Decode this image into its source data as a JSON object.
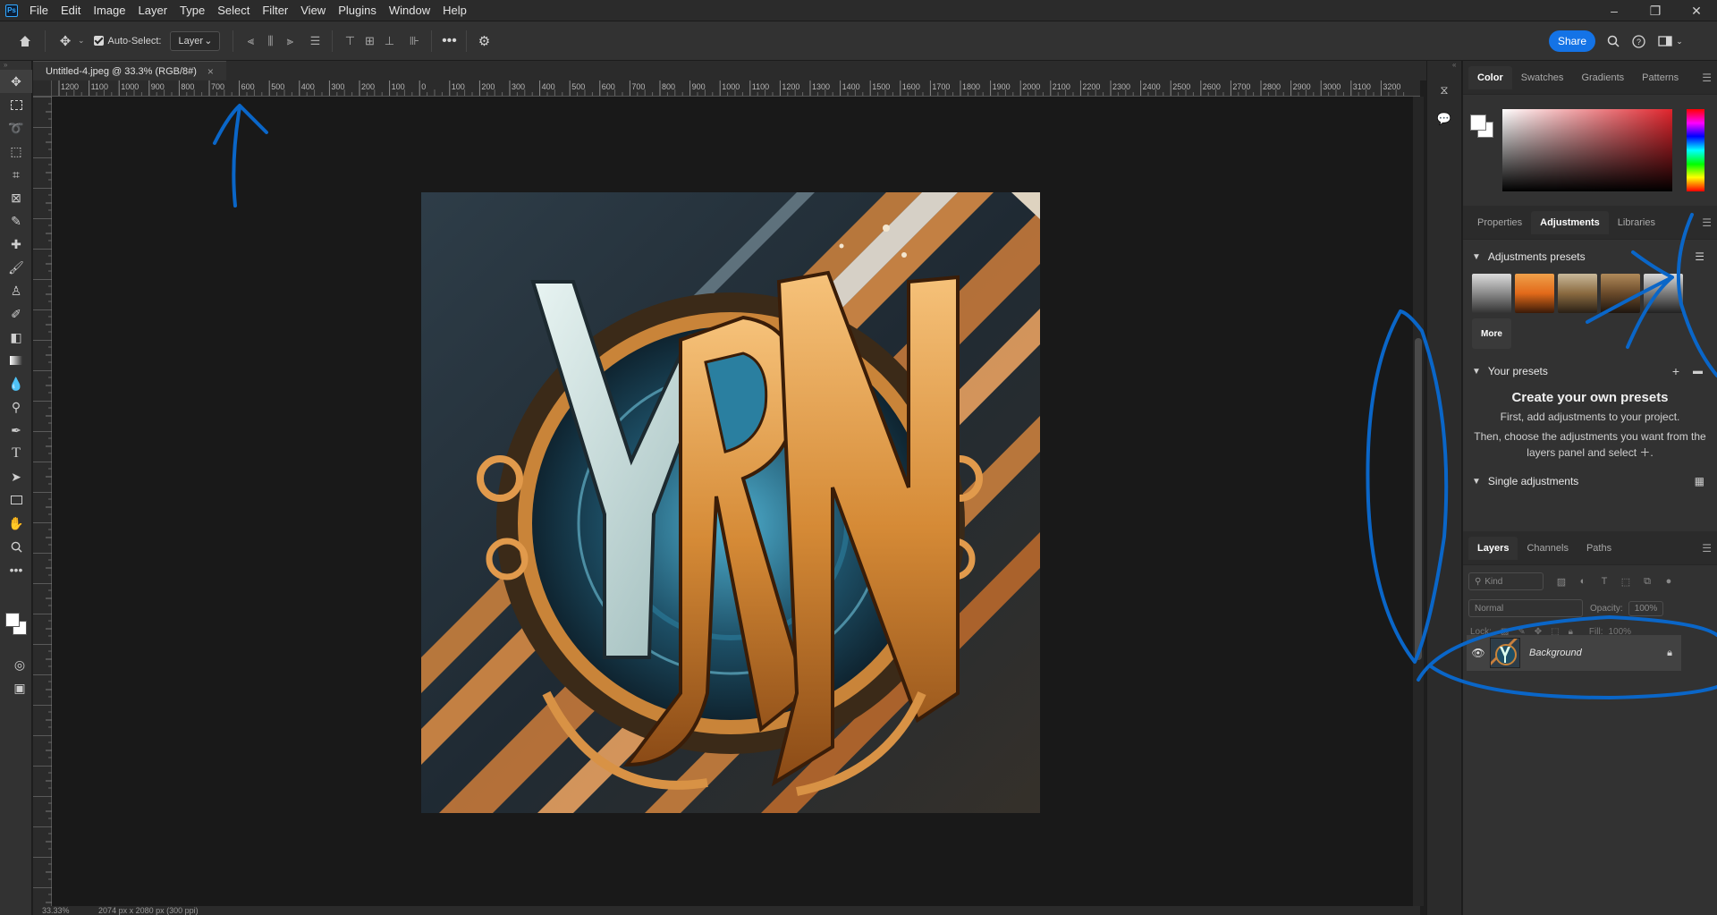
{
  "app": {
    "logo": "Ps"
  },
  "menu": [
    "File",
    "Edit",
    "Image",
    "Layer",
    "Type",
    "Select",
    "Filter",
    "View",
    "Plugins",
    "Window",
    "Help"
  ],
  "window_controls": {
    "minimize": "–",
    "restore": "❐",
    "close": "✕"
  },
  "options": {
    "auto_select_label": "Auto-Select:",
    "auto_select_value": "Layer",
    "share_label": "Share"
  },
  "document": {
    "tab_title": "Untitled-4.jpeg @ 33.3% (RGB/8#)",
    "close_glyph": "×",
    "status_zoom": "33.33%",
    "status_info": "2074 px x 2080 px (300 ppi)"
  },
  "ruler": {
    "labels": [
      "1200",
      "1100",
      "1000",
      "900",
      "800",
      "700",
      "600",
      "500",
      "400",
      "300",
      "200",
      "100",
      "0",
      "100",
      "200",
      "300",
      "400",
      "500",
      "600",
      "700",
      "800",
      "900",
      "1000",
      "1100",
      "1200",
      "1300",
      "1400",
      "1500",
      "1600",
      "1700",
      "1800",
      "1900",
      "2000",
      "2100",
      "2200",
      "2300",
      "2400",
      "2500",
      "2600",
      "2700",
      "2800",
      "2900",
      "3000",
      "3100",
      "3200"
    ]
  },
  "artwork": {
    "letters": "YRN"
  },
  "color_panel": {
    "tabs": [
      "Color",
      "Swatches",
      "Gradients",
      "Patterns"
    ],
    "active_tab": "Color",
    "foreground": "#ffffff",
    "background": "#ffffff",
    "hue": "#e0242c"
  },
  "adjustments_panel": {
    "tabs": [
      "Properties",
      "Adjustments",
      "Libraries"
    ],
    "active_tab": "Adjustments",
    "presets_title": "Adjustments presets",
    "more_label": "More",
    "your_presets_title": "Your presets",
    "create_title": "Create your own presets",
    "create_line1": "First, add adjustments to your project.",
    "create_line2": "Then, choose the adjustments you want from the",
    "create_line3": "layers panel and select ＋.",
    "single_adjustments_title": "Single adjustments"
  },
  "layers_panel": {
    "tabs": [
      "Layers",
      "Channels",
      "Paths"
    ],
    "active_tab": "Layers",
    "kind_placeholder": "Kind",
    "blend_mode": "Normal",
    "opacity_label": "Opacity:",
    "opacity_value": "100%",
    "lock_label": "Lock:",
    "fill_label": "Fill:",
    "fill_value": "100%",
    "layer_name": "Background"
  },
  "colors": {
    "accent": "#1473e6",
    "annotation": "#0a66c8"
  }
}
